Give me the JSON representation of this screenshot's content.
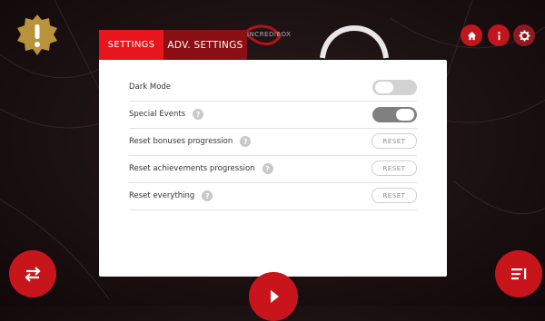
{
  "tabs": [
    {
      "label": "SETTINGS",
      "active": true
    },
    {
      "label": "ADV. SETTINGS",
      "active": false
    }
  ],
  "logo_text": "INCREDIBOX",
  "settings": [
    {
      "label": "Dark Mode",
      "help": false,
      "control": "toggle",
      "state": "off"
    },
    {
      "label": "Special Events",
      "help": true,
      "control": "toggle",
      "state": "on"
    },
    {
      "label": "Reset bonuses progression",
      "help": true,
      "control": "button",
      "button_label": "RESET"
    },
    {
      "label": "Reset achievements progression",
      "help": true,
      "control": "button",
      "button_label": "RESET"
    },
    {
      "label": "Reset everything",
      "help": true,
      "control": "button",
      "button_label": "RESET"
    }
  ],
  "help_glyph": "?",
  "icons": {
    "warning": "warning-badge-icon",
    "home": "home-icon",
    "info": "info-icon",
    "gear": "gear-icon",
    "swap": "swap-arrows-icon",
    "list": "list-icon",
    "play": "play-icon"
  },
  "colors": {
    "accent": "#e8161c",
    "tab_inactive": "#8a1015",
    "toggle_on": "#808080",
    "toggle_off": "#d2d2d2"
  }
}
